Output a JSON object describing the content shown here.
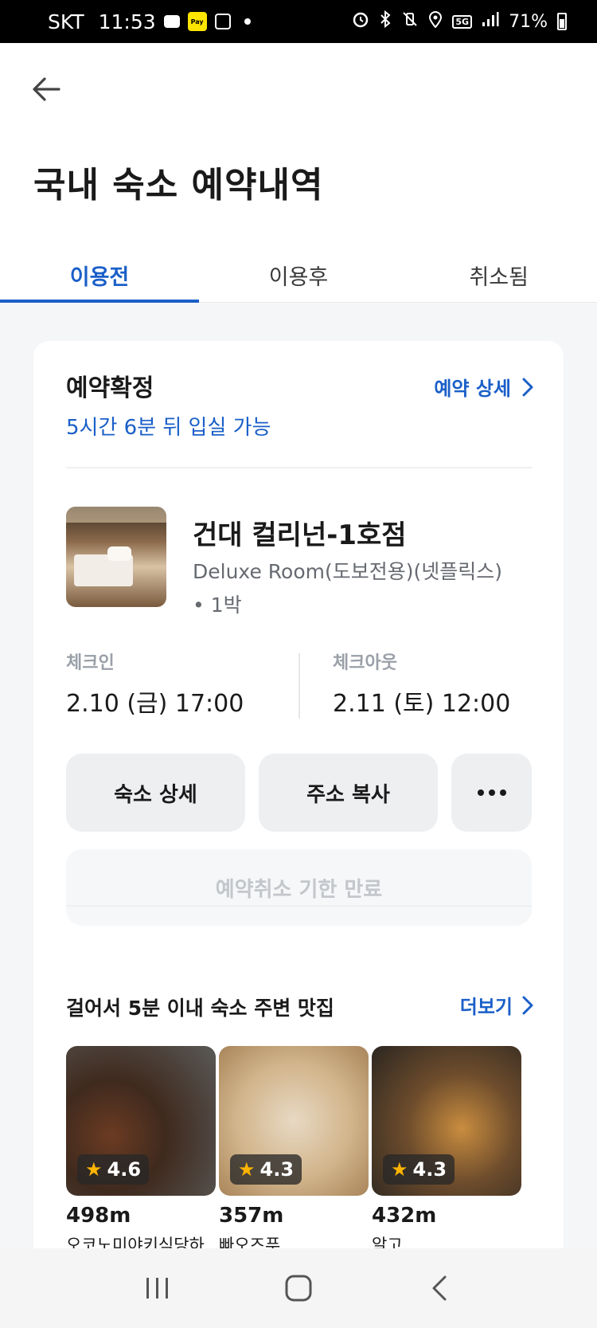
{
  "status_bar": {
    "carrier": "SKT",
    "time": "11:53",
    "network": "5G",
    "battery": "71%",
    "pay_badge": "Pay"
  },
  "header": {
    "back_icon": "arrow-left-icon",
    "title": "국내 숙소 예약내역"
  },
  "tabs": [
    {
      "label": "이용전",
      "active": true
    },
    {
      "label": "이용후",
      "active": false
    },
    {
      "label": "취소됨",
      "active": false
    }
  ],
  "reservation": {
    "status": "예약확정",
    "detail_link": "예약 상세",
    "subtitle": "5시간 6분 뒤 입실 가능",
    "hotel_name": "건대 컬리넌-1호점",
    "room_name": "Deluxe Room(도보전용)(넷플릭스)",
    "nights": "• 1박",
    "checkin_label": "체크인",
    "checkin_value": "2.10 (금) 17:00",
    "checkout_label": "체크아웃",
    "checkout_value": "2.11 (토) 12:00",
    "buttons": {
      "detail": "숙소 상세",
      "copy_address": "주소 복사",
      "more_icon": "more-dots-icon"
    },
    "cancel_notice": "예약취소 기한 만료"
  },
  "nearby": {
    "title": "걸어서 5분 이내 숙소 주변 맛집",
    "more_link": "더보기",
    "places": [
      {
        "rating": "4.6",
        "distance": "498m",
        "name": "오코노미야키식당하"
      },
      {
        "rating": "4.3",
        "distance": "357m",
        "name": "빠오즈푸"
      },
      {
        "rating": "4.3",
        "distance": "432m",
        "name": "알고"
      }
    ]
  },
  "colors": {
    "accent": "#1a5fc8",
    "background": "#f5f6f8",
    "disabled_text": "#c3c6cb"
  }
}
